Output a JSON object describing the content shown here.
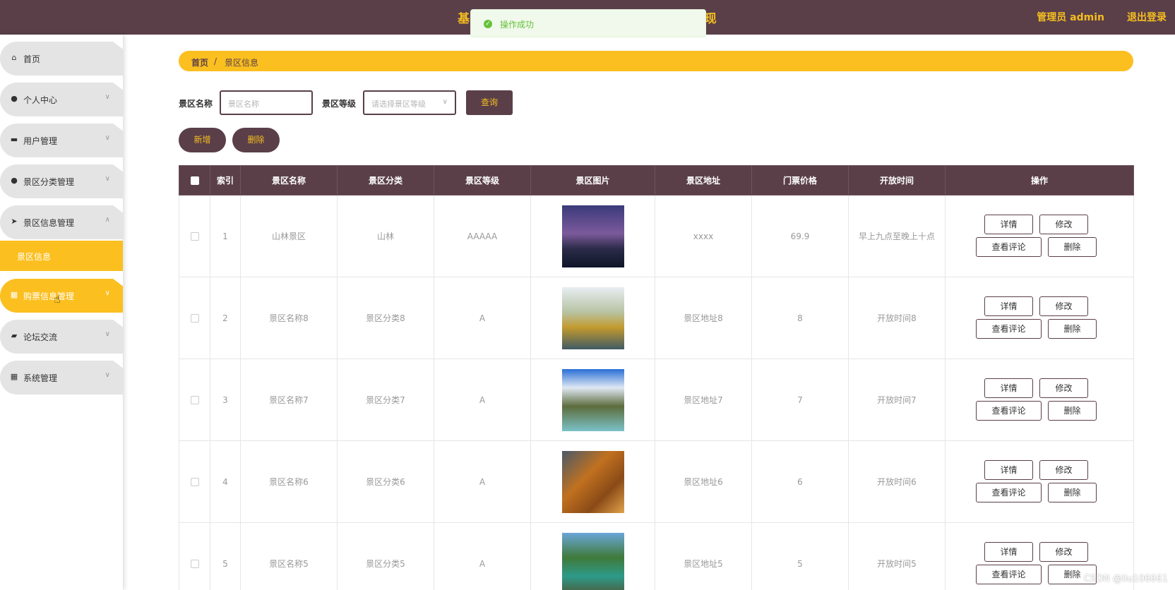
{
  "header": {
    "title": "基于SSM的旅游景区门票预订系统设计与实现",
    "user": "管理员 admin",
    "logout": "退出登录"
  },
  "toast": {
    "message": "操作成功"
  },
  "sidebar": {
    "items": [
      {
        "label": "首页",
        "icon": "home-icon"
      },
      {
        "label": "个人中心",
        "icon": "user-icon"
      },
      {
        "label": "用户管理",
        "icon": "briefcase-icon"
      },
      {
        "label": "景区分类管理",
        "icon": "bulb-icon"
      },
      {
        "label": "景区信息管理",
        "icon": "send-icon"
      },
      {
        "label": "购票信息管理",
        "icon": "grid-icon"
      },
      {
        "label": "论坛交流",
        "icon": "ticket-icon"
      },
      {
        "label": "系统管理",
        "icon": "grid-icon"
      }
    ],
    "submenu": {
      "label": "景区信息"
    }
  },
  "breadcrumb": {
    "home": "首页",
    "separator": "/",
    "current": "景区信息"
  },
  "search": {
    "name_label": "景区名称",
    "name_placeholder": "景区名称",
    "level_label": "景区等级",
    "level_placeholder": "请选择景区等级",
    "query_button": "查询"
  },
  "actions": {
    "add": "新增",
    "delete": "删除"
  },
  "table": {
    "headers": [
      "索引",
      "景区名称",
      "景区分类",
      "景区等级",
      "景区图片",
      "景区地址",
      "门票价格",
      "开放时间",
      "操作"
    ],
    "rows": [
      {
        "index": "1",
        "name": "山林景区",
        "category": "山林",
        "level": "AAAAA",
        "address": "xxxx",
        "price": "69.9",
        "time": "早上九点至晚上十点"
      },
      {
        "index": "2",
        "name": "景区名称8",
        "category": "景区分类8",
        "level": "A",
        "address": "景区地址8",
        "price": "8",
        "time": "开放时间8"
      },
      {
        "index": "3",
        "name": "景区名称7",
        "category": "景区分类7",
        "level": "A",
        "address": "景区地址7",
        "price": "7",
        "time": "开放时间7"
      },
      {
        "index": "4",
        "name": "景区名称6",
        "category": "景区分类6",
        "level": "A",
        "address": "景区地址6",
        "price": "6",
        "time": "开放时间6"
      },
      {
        "index": "5",
        "name": "景区名称5",
        "category": "景区分类5",
        "level": "A",
        "address": "景区地址5",
        "price": "5",
        "time": "开放时间5"
      }
    ],
    "ops": {
      "detail": "详情",
      "edit": "修改",
      "comments": "查看评论",
      "delete": "删除"
    }
  },
  "watermark": "CSDN @liu106661",
  "colors": {
    "primary": "#5a3f49",
    "accent": "#fbbf1f",
    "success": "#67c23a"
  }
}
